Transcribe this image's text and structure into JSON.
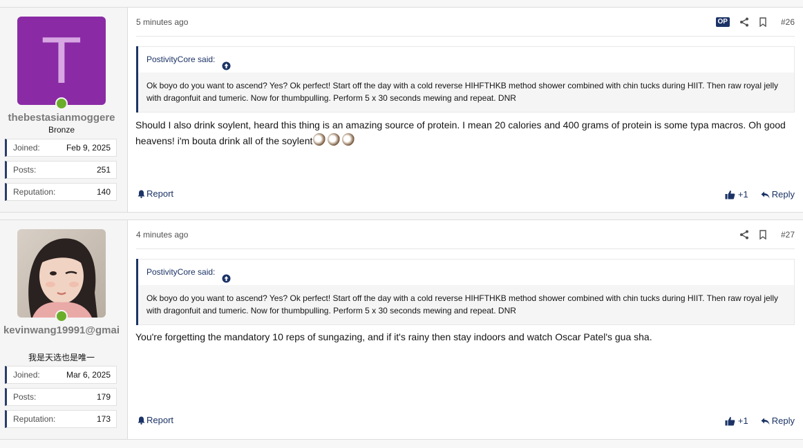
{
  "posts": [
    {
      "time": "5 minutes ago",
      "op_badge": "OP",
      "number": "#26",
      "user": {
        "avatar_letter": "T",
        "avatar_color": "#8a2ba5",
        "name": "thebestasianmoggere",
        "title": "Bronze",
        "stats": [
          {
            "label": "Joined:",
            "value": "Feb 9, 2025"
          },
          {
            "label": "Posts:",
            "value": "251"
          },
          {
            "label": "Reputation:",
            "value": "140"
          }
        ]
      },
      "quote": {
        "author": "PostivityCore said:",
        "text": "Ok boyo do you want to ascend? Yes? Ok perfect! Start off the day with a cold reverse HIHFTHKB method shower combined with chin tucks during HIIT. Then raw royal jelly with dragonfuit and tumeric. Now for thumbpulling. Perform 5 x 30 seconds mewing and repeat. DNR"
      },
      "message": "Should I also drink soylent, heard this thing is an amazing source of protein. I mean 20 calories and 400 grams of protein is some typa macros. Oh good heavens! i'm bouta drink all of the soylent",
      "report": "Report",
      "reaction": "+1",
      "reply": "Reply"
    },
    {
      "time": "4 minutes ago",
      "number": "#27",
      "user": {
        "name": "kevinwang19991@gmai",
        "title": "我是天选也是唯一",
        "stats": [
          {
            "label": "Joined:",
            "value": "Mar 6, 2025"
          },
          {
            "label": "Posts:",
            "value": "179"
          },
          {
            "label": "Reputation:",
            "value": "173"
          }
        ]
      },
      "quote": {
        "author": "PostivityCore said:",
        "text": "Ok boyo do you want to ascend? Yes? Ok perfect! Start off the day with a cold reverse HIHFTHKB method shower combined with chin tucks during HIIT. Then raw royal jelly with dragonfuit and tumeric. Now for thumbpulling. Perform 5 x 30 seconds mewing and repeat. DNR"
      },
      "message": "You're forgetting the mandatory 10 reps of sungazing, and if it's rainy then stay indoors and watch Oscar Patel's gua sha.",
      "report": "Report",
      "reaction": "+1",
      "reply": "Reply"
    }
  ],
  "colors": {
    "accent": "#1b3366",
    "online": "#6aad2a"
  }
}
